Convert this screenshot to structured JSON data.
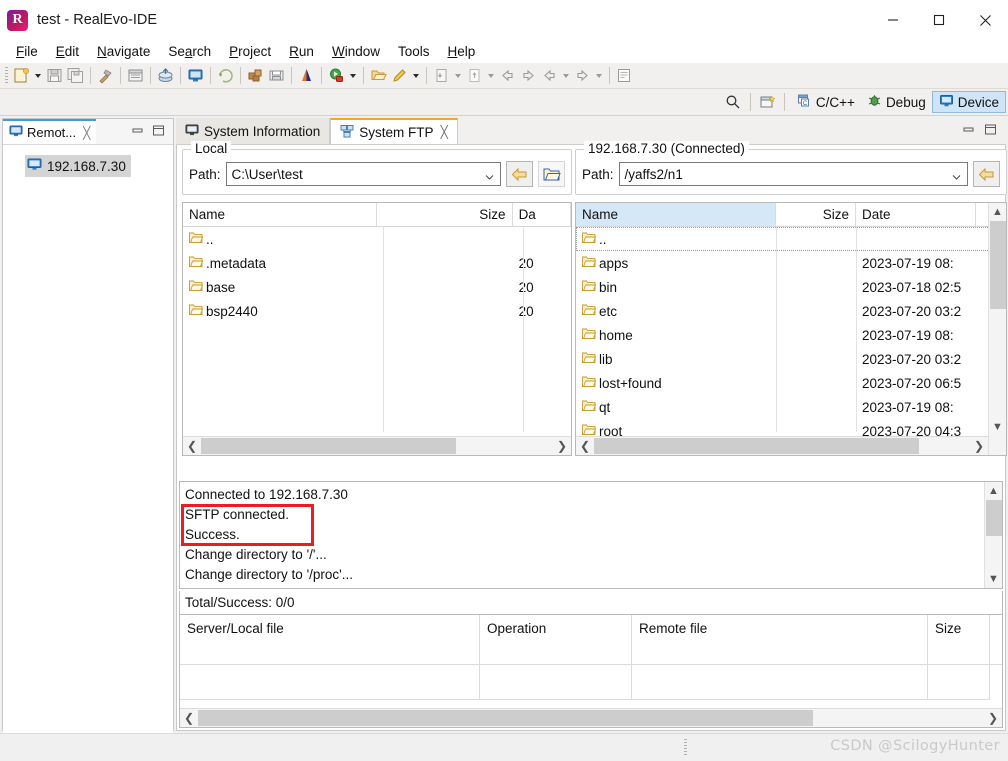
{
  "window": {
    "title": "test - RealEvo-IDE",
    "logo_letter": "R",
    "controls": {
      "minimize": "minimize-icon",
      "maximize": "maximize-icon",
      "close": "close-icon"
    }
  },
  "menubar": {
    "items": [
      {
        "label": "File",
        "mnemonic": "F"
      },
      {
        "label": "Edit",
        "mnemonic": "E"
      },
      {
        "label": "Navigate",
        "mnemonic": "N"
      },
      {
        "label": "Search",
        "mnemonic": "a"
      },
      {
        "label": "Project",
        "mnemonic": "P"
      },
      {
        "label": "Run",
        "mnemonic": "R"
      },
      {
        "label": "Window",
        "mnemonic": "W"
      },
      {
        "label": "Tools",
        "mnemonic": ""
      },
      {
        "label": "Help",
        "mnemonic": "H"
      }
    ]
  },
  "toolbar": {
    "icons": [
      "new-file-icon",
      "save-icon",
      "save-all-icon",
      "build-hammer-icon",
      "new-project-icon",
      "publish-icon",
      "console-icon",
      "run-last-icon",
      "build-all-icon",
      "open-folder-icon",
      "toolchain-icon",
      "run-icon",
      "open-resource-icon",
      "edit-icon",
      "import-icon",
      "export-icon",
      "back-icon",
      "forward-icon",
      "prev-icon",
      "next-icon",
      "new-editor-icon"
    ]
  },
  "perspectives": {
    "search_icon": "search-icon",
    "open_perspective_icon": "open-perspective-icon",
    "items": [
      {
        "label": "C/C++",
        "icon": "cpp-perspective-icon",
        "active": false
      },
      {
        "label": "Debug",
        "icon": "debug-perspective-icon",
        "active": false
      },
      {
        "label": "Device",
        "icon": "device-perspective-icon",
        "active": true
      }
    ]
  },
  "left_view": {
    "tab_label": "Remot...",
    "tab_icon": "monitor-icon",
    "close_icon": "close-icon",
    "minimize_icon": "minimize-icon",
    "maximize_icon": "maximize-icon",
    "tree_items": [
      {
        "label": "192.168.7.30",
        "icon": "monitor-icon",
        "selected": true
      }
    ]
  },
  "editor": {
    "tabs": [
      {
        "label": "System Information",
        "icon": "monitor-icon",
        "active": false,
        "closable": false
      },
      {
        "label": "System FTP",
        "icon": "ftp-icon",
        "active": true,
        "closable": true
      }
    ],
    "minimize_icon": "minimize-icon",
    "maximize_icon": "maximize-icon"
  },
  "local_pane": {
    "legend": "Local",
    "path_label": "Path:",
    "path_value": "C:\\User\\test",
    "path_placeholder": "",
    "back_button_icon": "back-arrow-icon",
    "browse_button_icon": "open-folder-icon",
    "columns": [
      {
        "label": "Name",
        "selected": false
      },
      {
        "label": "Size",
        "selected": false
      },
      {
        "label": "Da",
        "selected": false
      }
    ],
    "rows": [
      {
        "name": "..",
        "size": "",
        "date": "",
        "icon": "folder-icon"
      },
      {
        "name": ".metadata",
        "size": "",
        "date": "20",
        "icon": "folder-icon"
      },
      {
        "name": "base",
        "size": "",
        "date": "20",
        "icon": "folder-icon"
      },
      {
        "name": "bsp2440",
        "size": "",
        "date": "20",
        "icon": "folder-icon"
      }
    ]
  },
  "remote_pane": {
    "legend": "192.168.7.30 (Connected)",
    "path_label": "Path:",
    "path_value": "/yaffs2/n1",
    "path_placeholder": "",
    "back_button_icon": "back-arrow-icon",
    "columns": [
      {
        "label": "Name",
        "selected": true
      },
      {
        "label": "Size",
        "selected": false
      },
      {
        "label": "Date",
        "selected": false
      }
    ],
    "rows": [
      {
        "name": "..",
        "size": "",
        "date": "",
        "icon": "folder-icon"
      },
      {
        "name": "apps",
        "size": "",
        "date": "2023-07-19 08:",
        "icon": "folder-icon"
      },
      {
        "name": "bin",
        "size": "",
        "date": "2023-07-18 02:5",
        "icon": "folder-icon"
      },
      {
        "name": "etc",
        "size": "",
        "date": "2023-07-20 03:2",
        "icon": "folder-icon"
      },
      {
        "name": "home",
        "size": "",
        "date": "2023-07-19 08:",
        "icon": "folder-icon"
      },
      {
        "name": "lib",
        "size": "",
        "date": "2023-07-20 03:2",
        "icon": "folder-icon"
      },
      {
        "name": "lost+found",
        "size": "",
        "date": "2023-07-20 06:5",
        "icon": "folder-icon"
      },
      {
        "name": "qt",
        "size": "",
        "date": "2023-07-19 08:",
        "icon": "folder-icon"
      },
      {
        "name": "root",
        "size": "",
        "date": "2023-07-20 04:3",
        "icon": "folder-icon"
      }
    ]
  },
  "console": {
    "lines": [
      "Connected to 192.168.7.30",
      "SFTP connected.",
      "Success.",
      "Change directory to '/'...",
      "Change directory to '/proc'..."
    ],
    "highlight_color": "#ec1c24"
  },
  "transfer": {
    "summary": "Total/Success:  0/0",
    "columns": [
      "Server/Local file",
      "Operation",
      "Remote file",
      "Size"
    ],
    "rows": []
  },
  "statusbar": {
    "watermark": "CSDN @ScilogyHunter"
  }
}
